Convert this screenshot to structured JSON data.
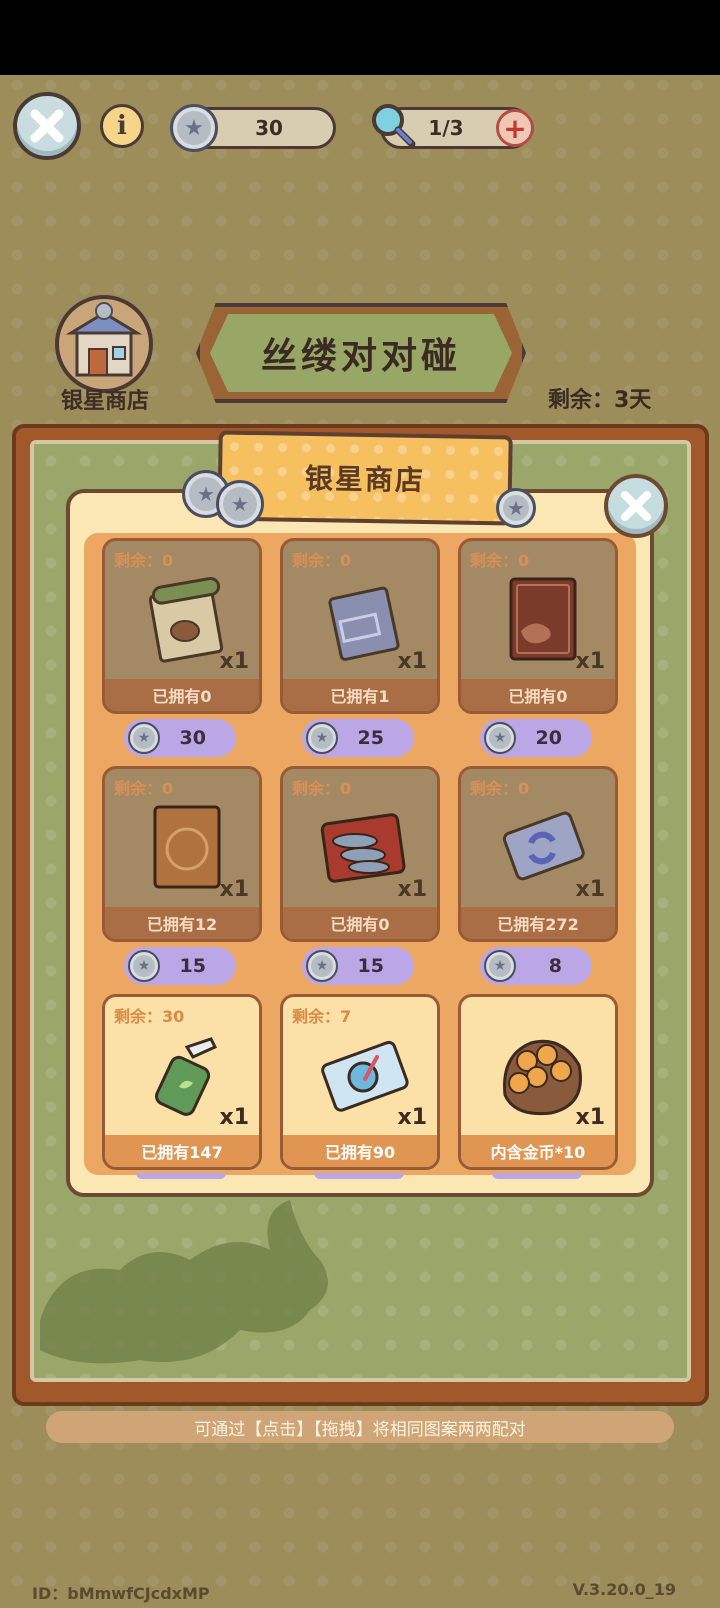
{
  "header": {
    "coin_icon": "silver-star-coin-icon",
    "coins": "30",
    "hint_icon": "magnifier-icon",
    "hints": "1/3"
  },
  "shop_entry": {
    "label": "银星商店"
  },
  "event": {
    "title": "丝缕对对碰",
    "remaining": "剩余：3天"
  },
  "shop": {
    "title": "银星商店",
    "items": [
      {
        "icon": "bonsai-scroll-icon",
        "stock": "剩余：0",
        "qty": "x1",
        "owned": "已拥有0",
        "price": "30",
        "sold_out": true
      },
      {
        "icon": "blueprint-scroll-icon",
        "stock": "剩余：0",
        "qty": "x1",
        "owned": "已拥有1",
        "price": "25",
        "sold_out": true
      },
      {
        "icon": "red-book-icon",
        "stock": "剩余：0",
        "qty": "x1",
        "owned": "已拥有0",
        "price": "20",
        "sold_out": true
      },
      {
        "icon": "brown-book-icon",
        "stock": "剩余：0",
        "qty": "x1",
        "owned": "已拥有12",
        "price": "15",
        "sold_out": true
      },
      {
        "icon": "fish-tray-icon",
        "stock": "剩余：0",
        "qty": "x1",
        "owned": "已拥有0",
        "price": "15",
        "sold_out": true
      },
      {
        "icon": "refresh-card-icon",
        "stock": "剩余：0",
        "qty": "x1",
        "owned": "已拥有272",
        "price": "8",
        "sold_out": true
      },
      {
        "icon": "spray-bottle-icon",
        "stock": "剩余：30",
        "qty": "x1",
        "owned": "已拥有147",
        "sold_out": false
      },
      {
        "icon": "stir-card-icon",
        "stock": "剩余：7",
        "qty": "x1",
        "owned": "已拥有90",
        "sold_out": false
      },
      {
        "icon": "gold-coin-bag-icon",
        "stock": "",
        "qty": "x1",
        "owned": "内含金币*10",
        "sold_out": false
      }
    ]
  },
  "footer": {
    "hint": "可通过【点击】【拖拽】将相同图案两两配对",
    "id": "ID：bMmwfCJcdxMP",
    "version": "V.3.20.0_19"
  },
  "colors": {
    "accent": "#eca763",
    "price_tag": "#bca7e6",
    "board": "#a1592c"
  }
}
